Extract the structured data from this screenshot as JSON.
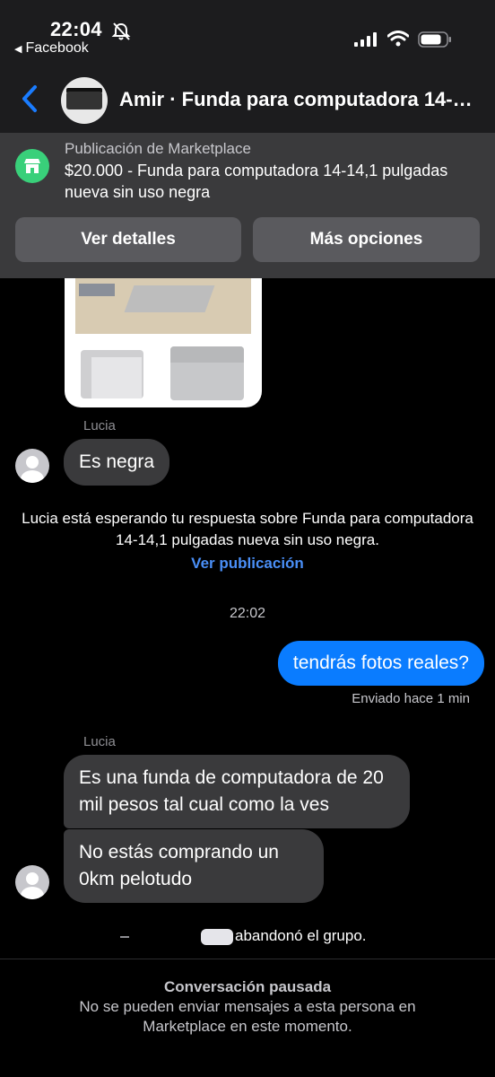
{
  "status_bar": {
    "time": "22:04",
    "back_app": "Facebook"
  },
  "header": {
    "title": "Amir · Funda para computadora 14-14,1 pulgadas nueva sin uso negra"
  },
  "marketplace": {
    "label": "Publicación de Marketplace",
    "title": "$20.000 - Funda para computadora 14-14,1 pulgadas nueva sin uso negra",
    "details_button": "Ver detalles",
    "options_button": "Más opciones",
    "icon_color": "#39d07a"
  },
  "chat": {
    "sender_1": "Lucia",
    "message_1": "Es negra",
    "system_notice": "Lucia está esperando tu respuesta sobre Funda para computadora 14-14,1 pulgadas nueva sin uso negra.",
    "system_link": "Ver publicación",
    "timestamp": "22:02",
    "outgoing_message": "tendrás fotos reales?",
    "sent_status": "Enviado hace 1 min",
    "sender_2": "Lucia",
    "message_2": "Es una funda de computadora de 20 mil pesos tal cual como la ves",
    "message_3": "No estás comprando un 0km pelotudo",
    "left_group": "abandonó el grupo.",
    "outgoing_color": "#0a7cff"
  },
  "footer": {
    "paused_title": "Conversación pausada",
    "paused_text": "No se pueden enviar mensajes a esta persona en Marketplace en este momento."
  }
}
